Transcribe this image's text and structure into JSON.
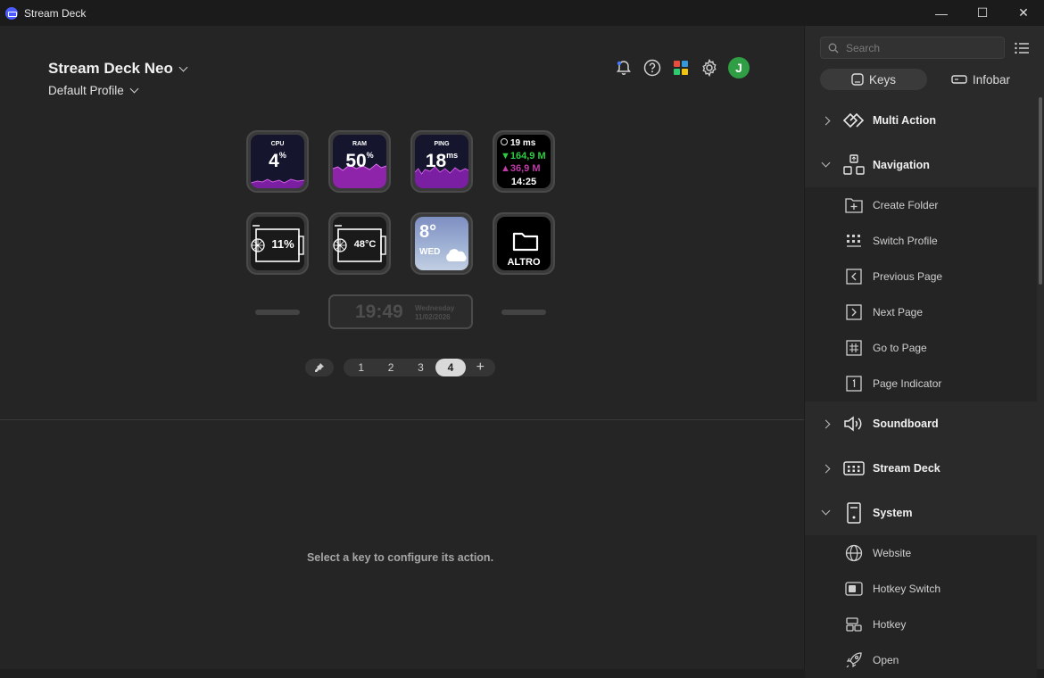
{
  "window": {
    "title": "Stream Deck",
    "minimize_glyph": "—",
    "maximize_glyph": "☐",
    "close_glyph": "✕"
  },
  "header": {
    "device_name": "Stream Deck Neo",
    "profile_name": "Default Profile"
  },
  "top_icons": [
    "bell-icon",
    "help-icon",
    "plugins-icon",
    "settings-icon"
  ],
  "user": {
    "initial": "J",
    "color": "#2f9e44"
  },
  "keys": {
    "cpu": {
      "label": "CPU",
      "value": "4",
      "unit": "%"
    },
    "ram": {
      "label": "RAM",
      "value": "50",
      "unit": "%"
    },
    "ping": {
      "label": "PING",
      "value": "18",
      "unit": "ms"
    },
    "network": {
      "latency": "19 ms",
      "download": "164,9 M",
      "upload": "36,9 M",
      "time": "14:25"
    },
    "gpu_usage": {
      "value": "11%"
    },
    "gpu_temp": {
      "value": "48°C"
    },
    "weather": {
      "temp": "8°",
      "day": "WED"
    },
    "folder": {
      "label": "ALTRO"
    }
  },
  "infobar": {
    "time": "19:49",
    "weekday": "Wednesday",
    "date": "11/02/2026"
  },
  "pages": {
    "items": [
      "1",
      "2",
      "3",
      "4"
    ],
    "active": "4",
    "add": "+"
  },
  "config_message": "Select a key to configure its action.",
  "sidebar": {
    "search_placeholder": "Search",
    "tabs": {
      "keys": "Keys",
      "infobar": "Infobar"
    },
    "categories": {
      "multi_action": "Multi Action",
      "navigation": "Navigation",
      "soundboard": "Soundboard",
      "stream_deck": "Stream Deck",
      "system": "System"
    },
    "navigation_items": [
      "Create Folder",
      "Switch Profile",
      "Previous Page",
      "Next Page",
      "Go to Page",
      "Page Indicator"
    ],
    "system_items": [
      "Website",
      "Hotkey Switch",
      "Hotkey",
      "Open"
    ]
  },
  "colors": {
    "accent_purple": "#a020c8",
    "net_green": "#2ecc40",
    "net_magenta": "#c03aa8"
  }
}
